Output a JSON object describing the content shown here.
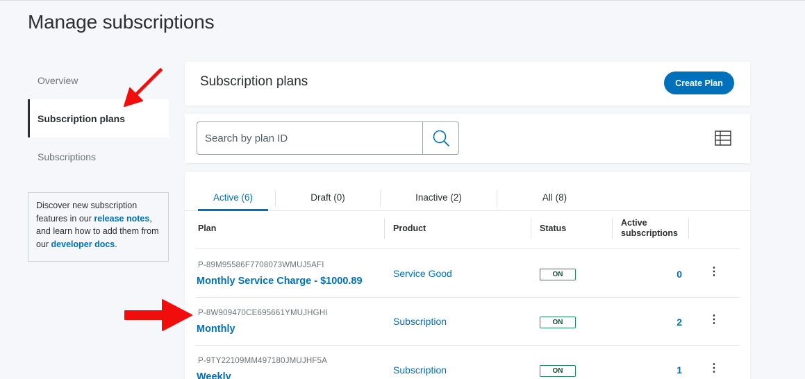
{
  "page": {
    "title": "Manage subscriptions"
  },
  "sidebar": {
    "items": [
      {
        "label": "Overview"
      },
      {
        "label": "Subscription plans"
      },
      {
        "label": "Subscriptions"
      }
    ],
    "info": {
      "text1": "Discover new subscription features in our ",
      "link1": "release notes",
      "text2": ", and learn how to add them from our ",
      "link2": "developer docs",
      "text3": "."
    }
  },
  "header": {
    "title": "Subscription plans",
    "create_label": "Create Plan"
  },
  "search": {
    "placeholder": "Search by plan ID"
  },
  "tabs": [
    {
      "label": "Active (6)"
    },
    {
      "label": "Draft (0)"
    },
    {
      "label": "Inactive (2)"
    },
    {
      "label": "All (8)"
    }
  ],
  "table": {
    "columns": [
      "Plan",
      "Product",
      "Status",
      "Active subscriptions"
    ],
    "rows": [
      {
        "id": "P-89M95586F7708073WMUJ5AFI",
        "name": "Monthly Service Charge - $1000.89",
        "product": "Service Good",
        "status": "ON",
        "count": "0"
      },
      {
        "id": "P-8W909470CE695661YMUJHGHI",
        "name": "Monthly",
        "product": "Subscription",
        "status": "ON",
        "count": "2"
      },
      {
        "id": "P-9TY22109MM497180JMUJHF5A",
        "name": "Weekly",
        "product": "Subscription",
        "status": "ON",
        "count": "1"
      }
    ]
  },
  "colors": {
    "accent": "#0070ba",
    "annotation_arrow": "#f20d0d",
    "status_border": "#1c8a5b"
  },
  "icons": {
    "search": "search-icon",
    "table_view": "table-view-icon",
    "more": "more-vertical-icon"
  }
}
